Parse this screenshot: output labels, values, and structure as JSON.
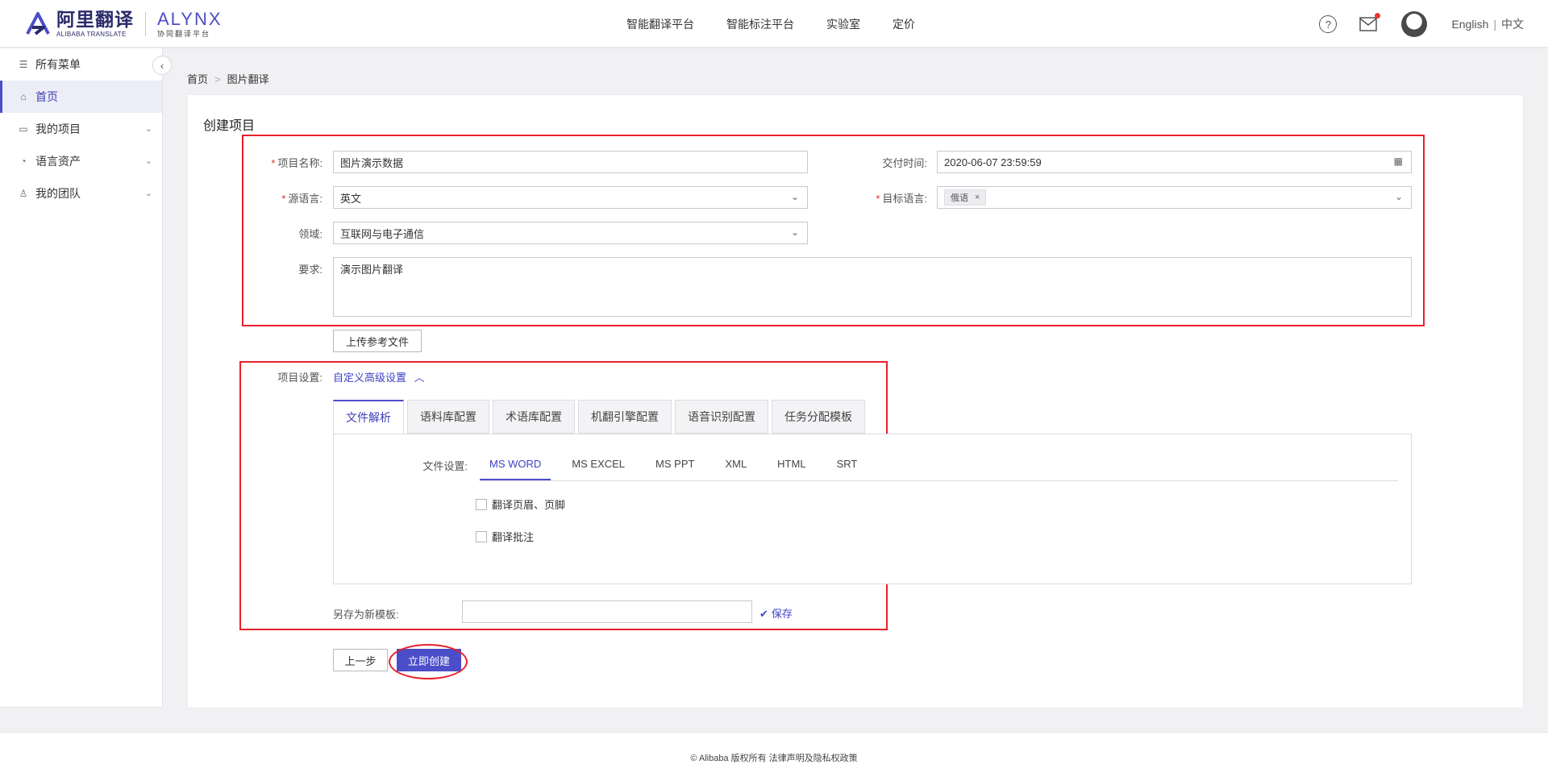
{
  "header": {
    "logo_cn": "阿里翻译",
    "logo_cn_sub": "ALIBABA TRANSLATE",
    "logo_alynx": "ALYNX",
    "logo_alynx_sub": "协同翻译平台",
    "nav": [
      "智能翻译平台",
      "智能标注平台",
      "实验室",
      "定价"
    ],
    "help": "?",
    "lang_en": "English",
    "lang_zh": "中文",
    "lang_sep": "|"
  },
  "sidebar": {
    "items": [
      {
        "label": "所有菜单",
        "icon": "list-icon"
      },
      {
        "label": "首页",
        "icon": "home-icon"
      },
      {
        "label": "我的项目",
        "icon": "folder-icon"
      },
      {
        "label": "语言资产",
        "icon": "clock-icon"
      },
      {
        "label": "我的团队",
        "icon": "user-icon"
      }
    ]
  },
  "breadcrumb": {
    "home": "首页",
    "current": "图片翻译",
    "sep": ">"
  },
  "form": {
    "title": "创建项目",
    "project_name_label": "项目名称:",
    "project_name_value": "图片演示数据",
    "delivery_label": "交付时间:",
    "delivery_value": "2020-06-07 23:59:59",
    "source_lang_label": "源语言:",
    "source_lang_value": "英文",
    "target_lang_label": "目标语言:",
    "target_lang_tag": "俄语",
    "domain_label": "领域:",
    "domain_value": "互联网与电子通信",
    "requirement_label": "要求:",
    "requirement_value": "演示图片翻译",
    "upload_btn": "上传参考文件",
    "settings_label": "项目设置:",
    "advanced_link": "自定义高级设置",
    "tabs": [
      "文件解析",
      "语料库配置",
      "术语库配置",
      "机翻引擎配置",
      "语音识别配置",
      "任务分配模板"
    ],
    "file_settings_label": "文件设置:",
    "subtabs": [
      "MS WORD",
      "MS EXCEL",
      "MS PPT",
      "XML",
      "HTML",
      "SRT"
    ],
    "check_header_footer": "翻译页眉、页脚",
    "check_comments": "翻译批注",
    "save_template_label": "另存为新模板:",
    "save_link": "保存",
    "prev_btn": "上一步",
    "create_btn": "立即创建"
  },
  "footer": {
    "text": "© Alibaba 版权所有 法律声明及隐私权政策"
  },
  "colors": {
    "accent": "#4b4dc9",
    "highlight": "#e8202a"
  }
}
